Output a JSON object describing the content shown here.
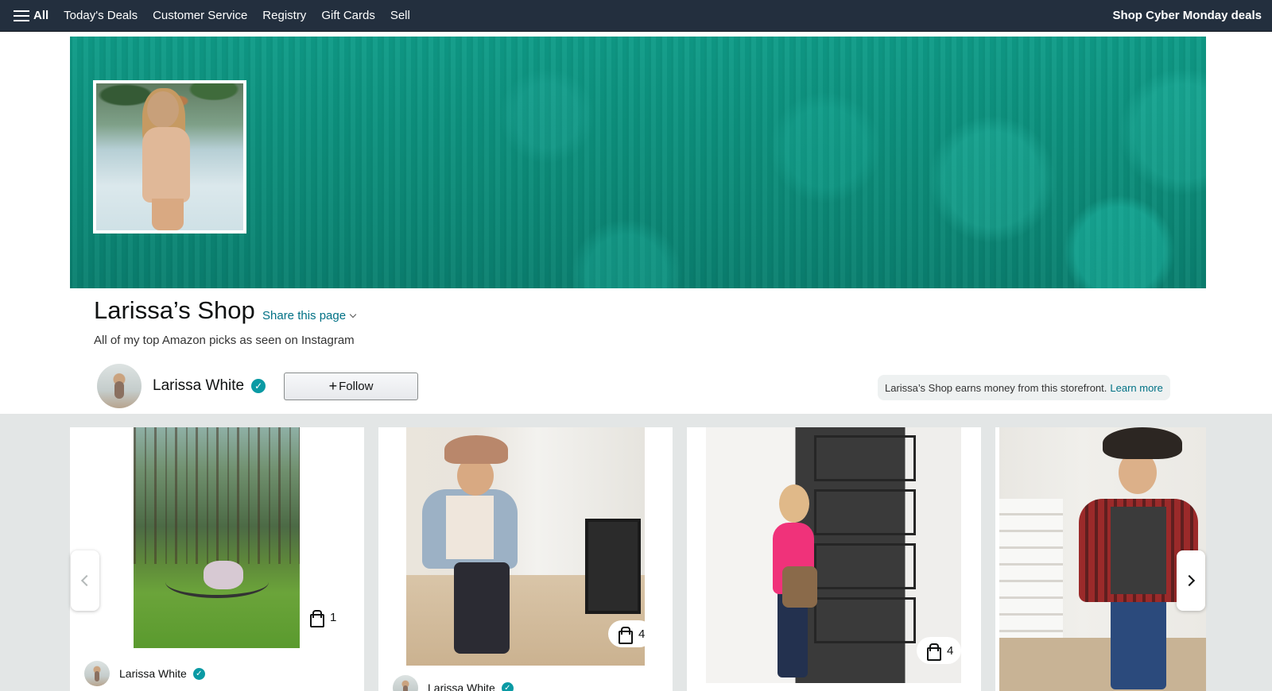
{
  "nav": {
    "all_label": "All",
    "links": [
      "Today's Deals",
      "Customer Service",
      "Registry",
      "Gift Cards",
      "Sell"
    ],
    "promo": "Shop Cyber Monday deals"
  },
  "shop": {
    "title": "Larissa’s Shop",
    "share_label": "Share this page",
    "description": "All of my top Amazon picks as seen on Instagram",
    "profile_name": "Larissa White",
    "follow_label": "Follow",
    "earn_note": "Larissa’s Shop earns money from this storefront.",
    "learn_more": "Learn more"
  },
  "feed": {
    "posts": [
      {
        "author": "Larissa White",
        "product_count": "1"
      },
      {
        "author": "Larissa White",
        "product_count": "4"
      },
      {
        "product_count": "4"
      },
      {}
    ]
  },
  "colors": {
    "nav_bg": "#232f3e",
    "banner": "#0f9c88",
    "link": "#007185",
    "verified": "#0a9aa4",
    "feed_bg": "#e3e6e6"
  },
  "icons": [
    "hamburger-icon",
    "verified-icon",
    "plus-icon",
    "chevron-down-icon",
    "shopping-bag-icon",
    "chevron-left-icon",
    "chevron-right-icon"
  ]
}
